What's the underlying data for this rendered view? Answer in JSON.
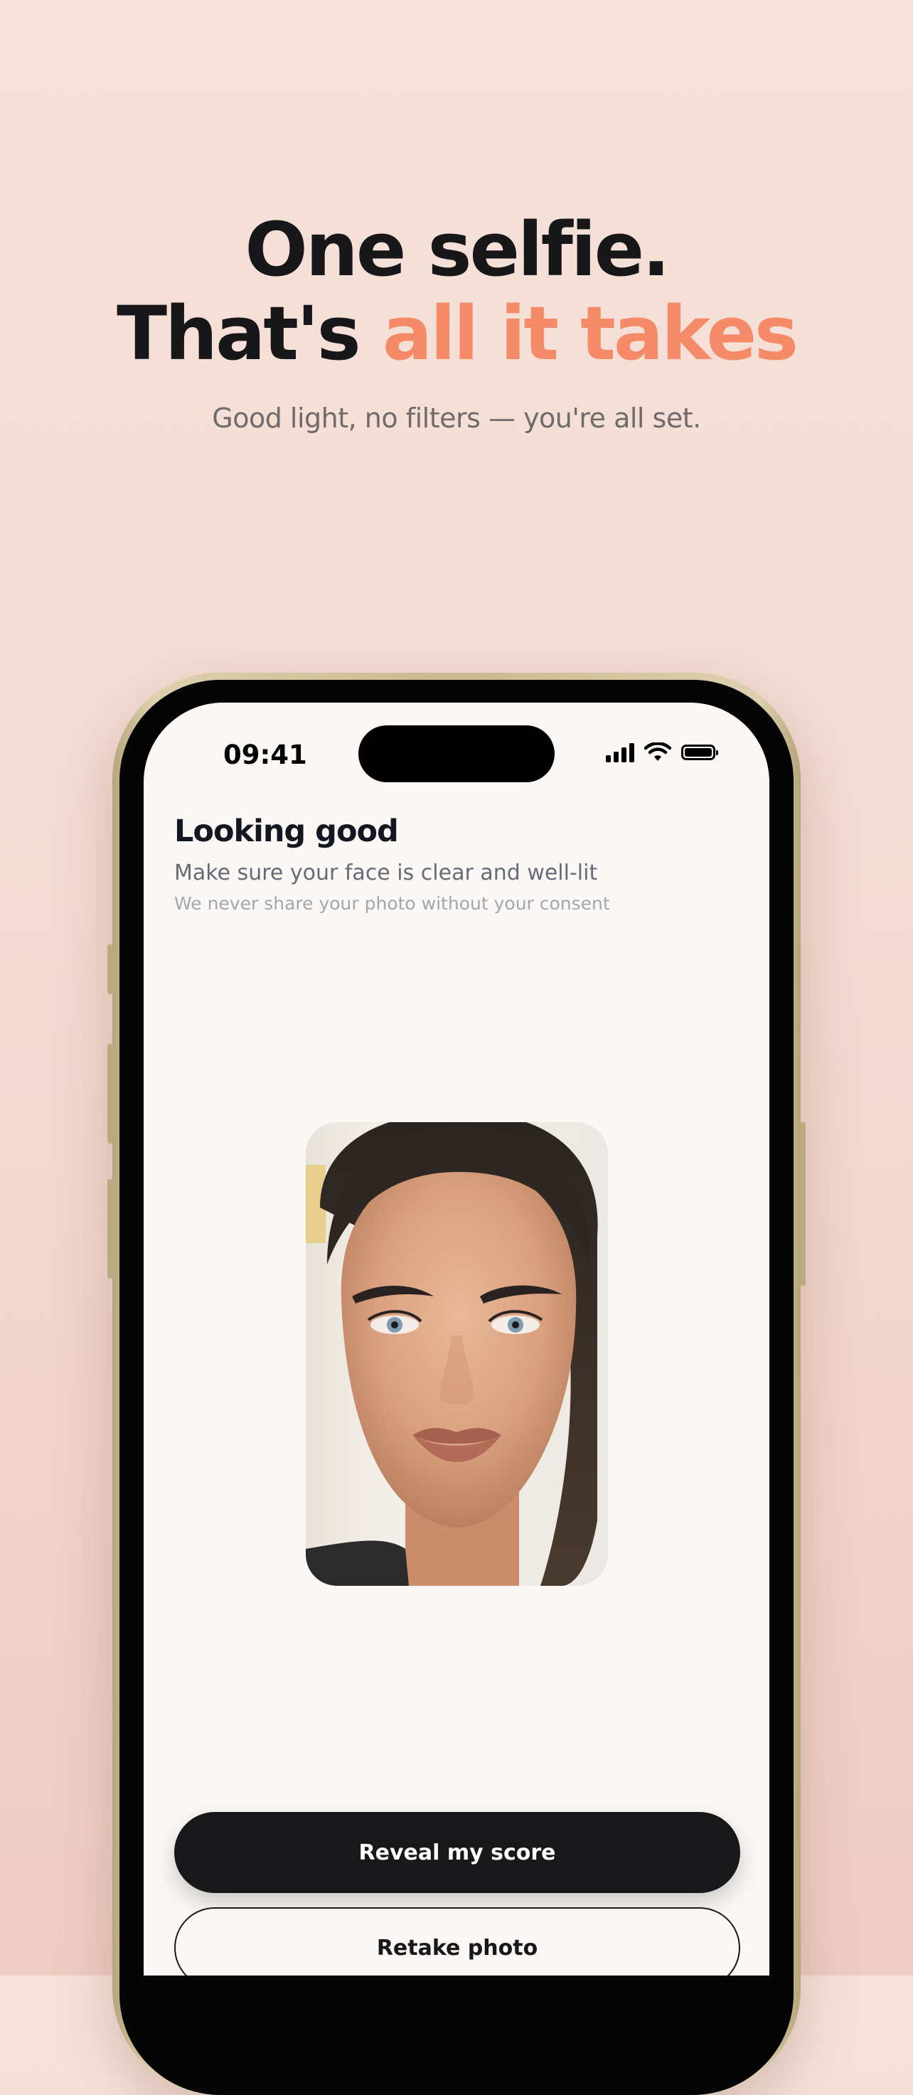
{
  "marketing": {
    "headline_line1": "One selfie.",
    "headline_line2_prefix": "That's ",
    "headline_line2_accent": "all it takes",
    "subhead": "Good light, no filters — you're all set."
  },
  "status_bar": {
    "time": "09:41"
  },
  "screen": {
    "title": "Looking good",
    "subtitle": "Make sure your face is clear and well-lit",
    "privacy_note": "We never share your photo without your consent"
  },
  "actions": {
    "primary_label": "Reveal my score",
    "secondary_label": "Retake photo"
  },
  "colors": {
    "background": "#f4dfd7",
    "accent": "#f58a68",
    "text_dark": "#17171a",
    "button_dark": "#18181b",
    "screen_bg": "#faf7f4"
  },
  "icons": [
    "signal-icon",
    "wifi-icon",
    "battery-icon"
  ]
}
